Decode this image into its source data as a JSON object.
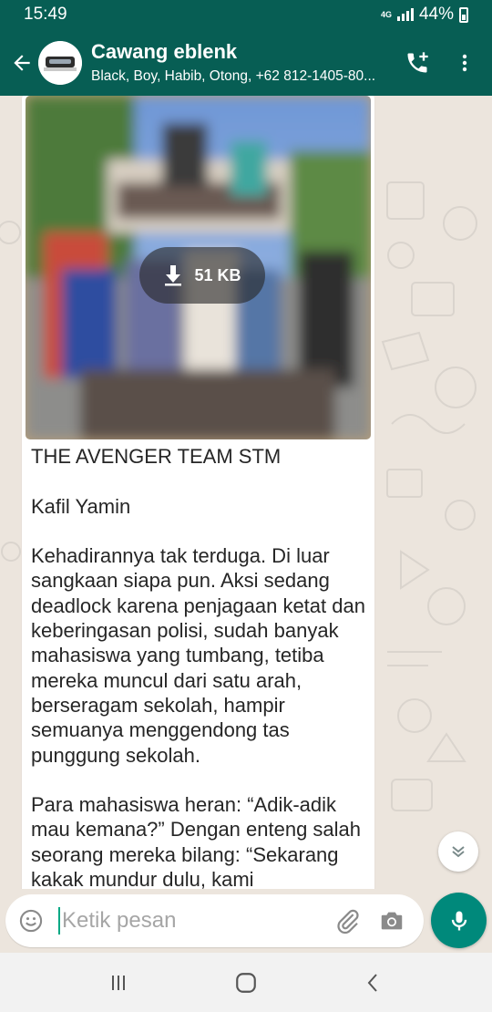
{
  "status_bar": {
    "time": "15:49",
    "network": "4G",
    "battery": "44%"
  },
  "header": {
    "title": "Cawang eblenk",
    "subtitle": "Black, Boy, Habib, Otong, +62 812-1405-80...",
    "icons": [
      "back-arrow-icon",
      "add-call-icon",
      "more-vert-icon"
    ]
  },
  "message": {
    "image_download_size": "51 KB",
    "paragraphs": [
      "THE AVENGER TEAM STM",
      "Kafil Yamin",
      "Kehadirannya tak terduga. Di luar sangkaan siapa pun. Aksi sedang deadlock karena penjagaan ketat dan keberingasan polisi, sudah banyak mahasiswa yang tumbang, tetiba mereka muncul dari satu arah, berseragam sekolah, hampir semuanya menggendong tas punggung sekolah.",
      "Para mahasiswa heran: “Adik-adik mau kemana?” Dengan enteng salah seorang mereka bilang: “Sekarang kakak mundur dulu, kami"
    ]
  },
  "composer": {
    "placeholder": "Ketik pesan",
    "value": ""
  },
  "colors": {
    "header": "#075e54",
    "chat_bg": "#ece5dd",
    "mic_button": "#00897b",
    "caret": "#00a884"
  }
}
